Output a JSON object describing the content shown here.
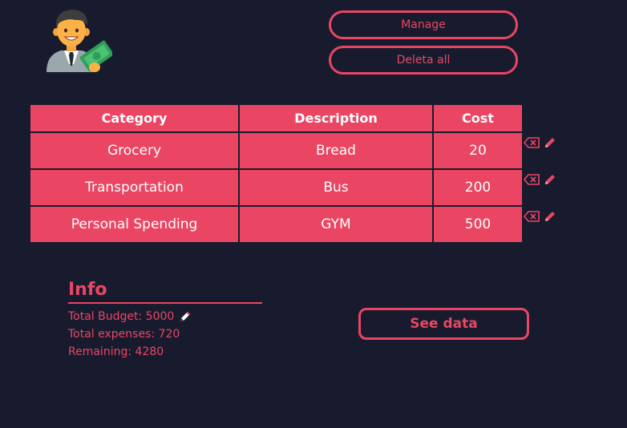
{
  "header": {
    "avatar_icon": "businessman-with-money-icon",
    "manage_label": "Manage",
    "delete_all_label": "Deleta all"
  },
  "table": {
    "columns": [
      "Category",
      "Description",
      "Cost"
    ],
    "rows": [
      {
        "category": "Grocery",
        "description": "Bread",
        "cost": "20"
      },
      {
        "category": "Transportation",
        "description": "Bus",
        "cost": "200"
      },
      {
        "category": "Personal Spending",
        "description": "GYM",
        "cost": "500"
      }
    ],
    "row_action_icons": [
      "delete-icon",
      "edit-pencil-icon"
    ]
  },
  "info": {
    "title": "Info",
    "total_budget": "Total Budget: 5000",
    "total_expenses": "Total expenses: 720",
    "remaining": "Remaining: 4280",
    "edit_icon": "pencil-icon"
  },
  "see_data_label": "See data",
  "colors": {
    "background": "#181b2e",
    "accent": "#ea4663",
    "cell_text": "#ffffff"
  }
}
